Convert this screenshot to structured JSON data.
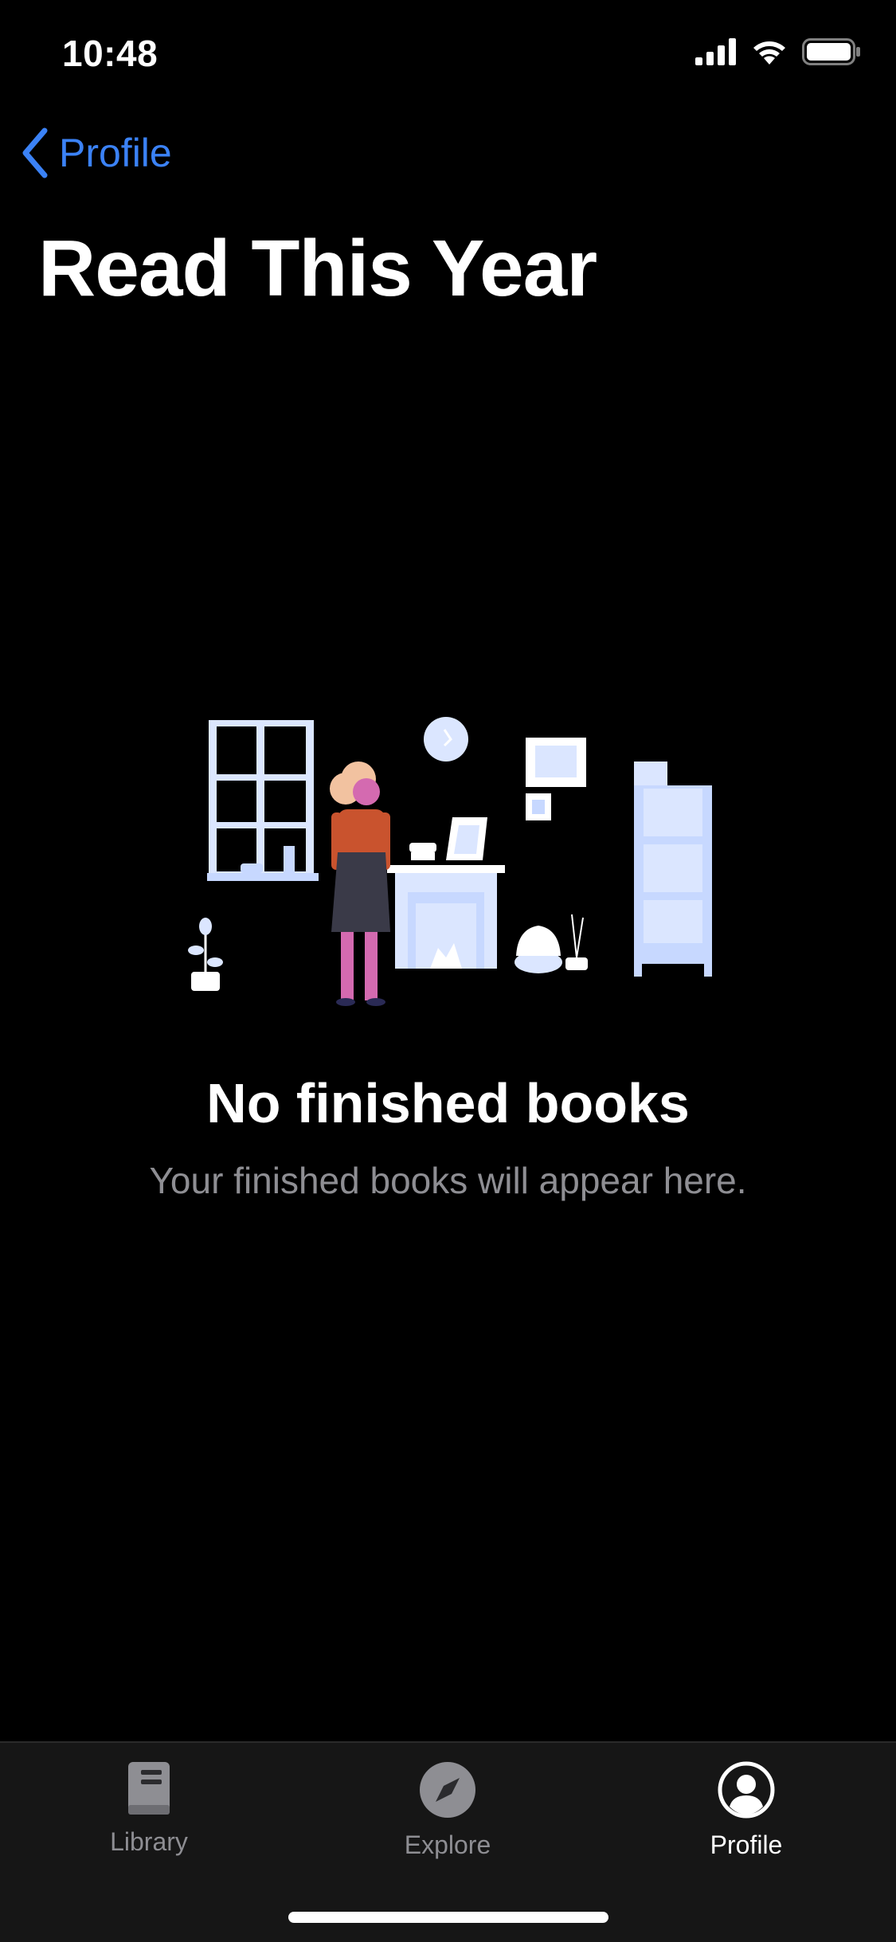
{
  "status_bar": {
    "time": "10:48"
  },
  "nav": {
    "back_label": "Profile"
  },
  "page": {
    "title": "Read This Year"
  },
  "empty_state": {
    "title": "No finished books",
    "subtitle": "Your finished books will appear here."
  },
  "tab_bar": {
    "tabs": [
      {
        "label": "Library",
        "icon": "book-icon",
        "active": false
      },
      {
        "label": "Explore",
        "icon": "compass-icon",
        "active": false
      },
      {
        "label": "Profile",
        "icon": "person-icon",
        "active": true
      }
    ]
  },
  "colors": {
    "accent": "#3b82f6",
    "background": "#000000",
    "tab_bar_bg": "#161616",
    "inactive": "#8e8e93"
  }
}
